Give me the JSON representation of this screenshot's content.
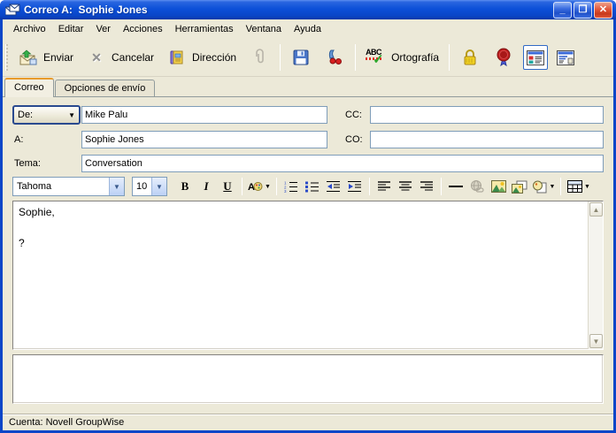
{
  "window": {
    "title": "Correo A:  Sophie Jones",
    "controls": {
      "minimize": "_",
      "maximize": "❐",
      "close": "✕"
    }
  },
  "menu": {
    "items": [
      "Archivo",
      "Editar",
      "Ver",
      "Acciones",
      "Herramientas",
      "Ventana",
      "Ayuda"
    ]
  },
  "toolbar": {
    "send_label": "Enviar",
    "cancel_label": "Cancelar",
    "address_label": "Dirección",
    "spell_label": "Ortografía",
    "spell_abc": "ABC"
  },
  "tabs": [
    {
      "label": "Correo",
      "active": true
    },
    {
      "label": "Opciones de envío",
      "active": false
    }
  ],
  "fields": {
    "de_label": "De:",
    "de_value": "Mike Palu",
    "a_label": "A:",
    "a_value": "Sophie Jones",
    "tema_label": "Tema:",
    "tema_value": "Conversation",
    "cc_label": "CC:",
    "cc_value": "",
    "co_label": "CO:",
    "co_value": ""
  },
  "format_toolbar": {
    "font_name": "Tahoma",
    "font_size": "10",
    "bold": "B",
    "italic": "I",
    "underline": "U"
  },
  "body": {
    "text": "Sophie,\n\n?"
  },
  "statusbar": {
    "text": "Cuenta: Novell GroupWise"
  },
  "colors": {
    "titlebar_blue": "#0A46C8",
    "chrome_beige": "#ECE9D8",
    "field_border": "#7F9DB9",
    "active_tab_accent": "#E89B2C",
    "close_red": "#E1563A"
  }
}
